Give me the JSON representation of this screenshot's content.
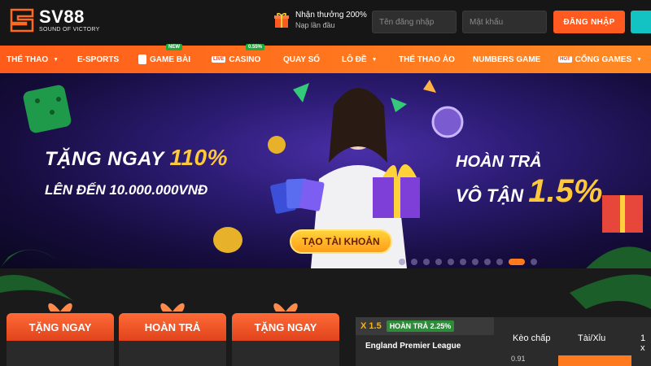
{
  "header": {
    "logo_name": "SV88",
    "logo_tagline": "SOUND OF VICTORY",
    "promo_title": "Nhận thưởng 200%",
    "promo_sub": "Nạp lần đầu",
    "username_placeholder": "Tên đăng nhập",
    "password_placeholder": "Mật khẩu",
    "login_label": "ĐĂNG NHẬP"
  },
  "nav": {
    "items": [
      {
        "label": "THỂ THAO"
      },
      {
        "label": "E-SPORTS"
      },
      {
        "label": "GAME BÀI",
        "badge": "NEW"
      },
      {
        "label": "CASINO",
        "badge": "0.55%",
        "tag": "LIVE"
      },
      {
        "label": "QUAY SỐ"
      },
      {
        "label": "LÔ ĐỀ"
      },
      {
        "label": "THỂ THAO ẢO"
      },
      {
        "label": "NUMBERS GAME"
      },
      {
        "label": "CỔNG GAMES",
        "tag": "HOT"
      }
    ]
  },
  "banner": {
    "left_line1_prefix": "TẶNG NGAY ",
    "left_line1_highlight": "110%",
    "left_line2": "LÊN ĐẾN 10.000.000VNĐ",
    "right_line1": "HOÀN TRẢ",
    "right_line2_prefix": "VÔ TẬN ",
    "right_line2_highlight": "1.5%",
    "cta_label": "TẠO TÀI KHOẢN",
    "slide_count": 11,
    "active_slide": 9
  },
  "promos": [
    {
      "label": "TẶNG NGAY"
    },
    {
      "label": "HOÀN TRẢ"
    },
    {
      "label": "TẶNG NGAY"
    }
  ],
  "odds": {
    "multiplier": "X 1.5",
    "rebate": "HOÀN TRẢ 2.25%",
    "league": "England Premier League",
    "col_handicap": "Kèo chấp",
    "col_overunder": "Tài/Xỉu",
    "col_1x2": "1 x",
    "value": "0.91"
  },
  "colors": {
    "accent": "#ff5a1f",
    "nav_gradient_start": "#ff5b1a",
    "highlight_yellow": "#ffc83a",
    "badge_green": "#1faa3c"
  }
}
